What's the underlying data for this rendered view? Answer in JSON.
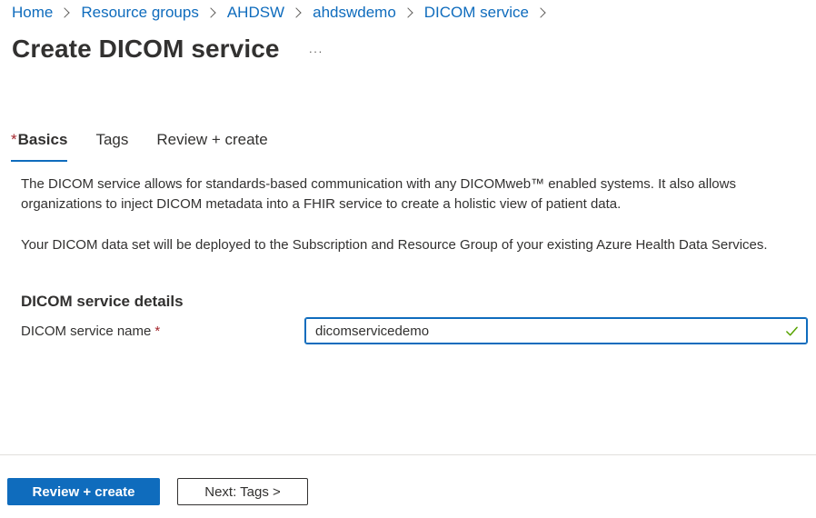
{
  "breadcrumb": [
    {
      "label": "Home"
    },
    {
      "label": "Resource groups"
    },
    {
      "label": "AHDSW"
    },
    {
      "label": "ahdswdemo"
    },
    {
      "label": "DICOM service"
    }
  ],
  "header": {
    "title": "Create DICOM service",
    "more_label": "···"
  },
  "tabs": [
    {
      "label": "Basics",
      "required_marker": "*",
      "active": true
    },
    {
      "label": "Tags"
    },
    {
      "label": "Review + create"
    }
  ],
  "description": {
    "paragraph1": "The DICOM service allows for standards-based communication with any DICOMweb™ enabled systems. It also allows organizations to inject DICOM metadata into a FHIR service to create a holistic view of patient data.",
    "paragraph2": "Your DICOM data set will be deployed to the Subscription and Resource Group of your existing Azure Health Data Services."
  },
  "details": {
    "section_title": "DICOM service details",
    "name_label": "DICOM service name",
    "required_marker": "*",
    "name_value": "dicomservicedemo",
    "validation_icon": "checkmark-icon",
    "validation_color": "#57a300"
  },
  "footer": {
    "review_create_label": "Review + create",
    "next_label": "Next: Tags >"
  },
  "colors": {
    "accent": "#0f6cbd",
    "required": "#a4262c"
  }
}
